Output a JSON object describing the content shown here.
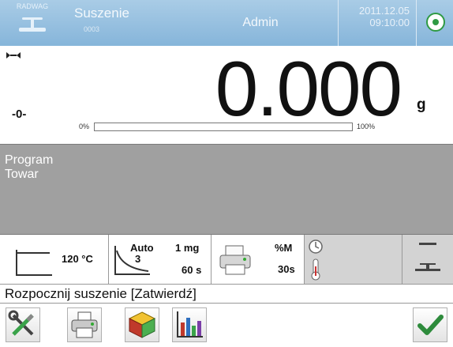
{
  "header": {
    "logo_text": "RADWAG",
    "mode_title": "Suszenie",
    "mode_sub": "0003",
    "user": "Admin",
    "date": "2011.12.05",
    "time": "09:10:00",
    "accent": "#86b5da"
  },
  "weighing": {
    "zero_indicator": "-0-",
    "value": "0.000",
    "unit": "g",
    "progress_min": "0%",
    "progress_max": "100%",
    "progress_fraction": 0.0
  },
  "info": {
    "line1": "Program",
    "line2": "Towar"
  },
  "params": {
    "temperature": "120 °C",
    "auto_label": "Auto",
    "auto_value": "3",
    "mass_step": "1 mg",
    "time_step": "60 s",
    "print_unit": "%M",
    "print_interval": "30s"
  },
  "message": "Rozpocznij suszenie [Zatwierdź]",
  "toolbar": {
    "icons": [
      "tools-icon",
      "printer-icon",
      "database-icon",
      "chart-icon",
      "confirm-icon"
    ],
    "confirm_color": "#2e8b3c"
  }
}
